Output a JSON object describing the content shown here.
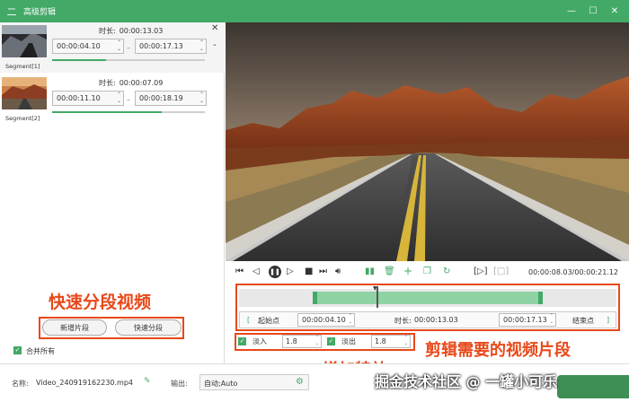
{
  "window": {
    "title": "高级剪辑",
    "logo": "二"
  },
  "window_controls": {
    "min": "—",
    "max": "☐",
    "close": "✕"
  },
  "segments": [
    {
      "label": "Segment[1]",
      "duration_label": "时长:",
      "duration": "00:00:13.03",
      "start": "00:00:04.10",
      "end": "00:00:17.13"
    },
    {
      "label": "Segment[2]",
      "duration_label": "时长:",
      "duration": "00:00:07.09",
      "start": "00:00:11.10",
      "end": "00:00:18.19"
    }
  ],
  "segment_progress": [
    0.35,
    0.72
  ],
  "annotations": {
    "quick_split_video": "快速分段视频",
    "trim_clips": "剪辑需要的视频片段",
    "add_effects": "增加特效"
  },
  "buttons": {
    "add_segment": "新增片段",
    "quick_split": "快速分段"
  },
  "merge_all": {
    "label": "合并所有",
    "checked": true
  },
  "player": {
    "time": "00:00:08.03/00:00:21.12"
  },
  "trim": {
    "start_label": "起始点",
    "start_bracket": "[",
    "start_value": "00:00:04.10",
    "duration_label": "时长:",
    "duration_value": "00:00:13.03",
    "end_value": "00:00:17.13",
    "end_label": "结束点",
    "end_bracket": "]"
  },
  "effects": {
    "fade_in_label": "淡入",
    "fade_in_value": "1.8",
    "fade_in_checked": true,
    "fade_out_label": "淡出",
    "fade_out_value": "1.8",
    "fade_out_checked": true
  },
  "bottom": {
    "name_label": "名称:",
    "file_name": "Video_240919162230.mp4",
    "output_label": "输出:",
    "output_value": "自动;Auto"
  },
  "watermark": "掘金技术社区 @ 一罐小可乐",
  "colors": {
    "accent": "#43a967",
    "annotation": "#e94819"
  }
}
